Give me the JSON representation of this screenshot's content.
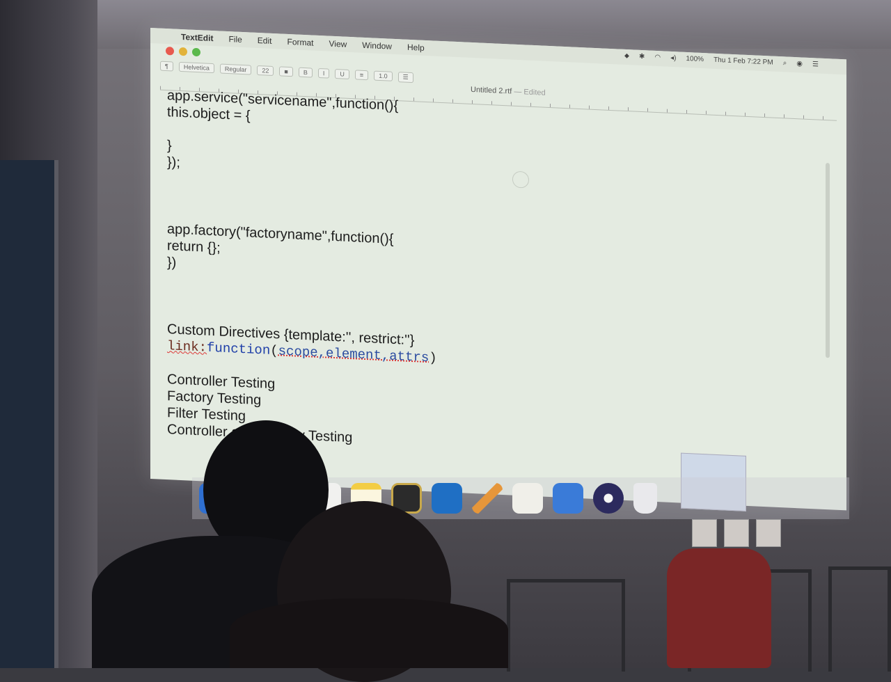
{
  "menubar": {
    "app_name": "TextEdit",
    "items": [
      "File",
      "Edit",
      "Format",
      "View",
      "Window",
      "Help"
    ]
  },
  "status": {
    "battery": "100%",
    "clock": "Thu 1 Feb  7:22 PM"
  },
  "toolbar": {
    "font_family": "Helvetica",
    "font_style": "Regular",
    "font_size": "22",
    "line_spacing": "1.0"
  },
  "document": {
    "title": "Untitled 2.rtf",
    "state": "— Edited"
  },
  "editor": {
    "lines": [
      "app.service(\"servicename\",function(){",
      "this.object = {",
      "",
      "}",
      "});",
      "",
      "",
      "",
      "app.factory(\"factoryname\",function(){",
      "return {};",
      "})",
      "",
      "",
      "",
      "Custom Directives {template:'', restrict:''}"
    ],
    "link_line": {
      "keyword": "link:",
      "fn": "function",
      "open": "(",
      "args": "scope,element,attrs",
      "close": ")"
    },
    "tail_lines": [
      "",
      "Controller Testing",
      "Factory Testing",
      "Filter Testing",
      "Controller and Factory Testing"
    ]
  },
  "dock": {
    "icons": [
      "finder-icon",
      "chrome-icon",
      "mouse-icon",
      "textedit-icon",
      "notes-icon",
      "media-icon",
      "vscode-icon",
      "pencil-icon",
      "document-icon",
      "xcode-icon",
      "eclipse-icon",
      "trash-icon"
    ]
  }
}
